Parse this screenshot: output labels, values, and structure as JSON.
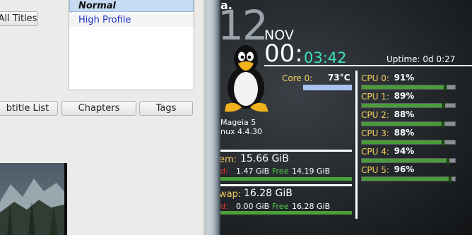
{
  "app": {
    "buttons": {
      "all_titles": "All Titles",
      "subtitle_list": "btitle List",
      "chapters": "Chapters",
      "tags": "Tags"
    },
    "tree": {
      "selected_label": "Normal",
      "item_label": "High Profile"
    }
  },
  "conky": {
    "top_fragment": "a.",
    "day": "12",
    "month": "NOV",
    "hours": "00:",
    "minutes_seconds": "03:42",
    "uptime": "Uptime: 0d 0:27",
    "core": {
      "label": "Core 0:",
      "temp": "73°C"
    },
    "distro": "Mageia 5",
    "kernel": "nux 4.4.30",
    "cpus": [
      {
        "label": "CPU 0:",
        "value": "91%",
        "level": 0.91
      },
      {
        "label": "CPU 1:",
        "value": "89%",
        "level": 0.89
      },
      {
        "label": "CPU 2:",
        "value": "88%",
        "level": 0.88
      },
      {
        "label": "CPU 3:",
        "value": "88%",
        "level": 0.88
      },
      {
        "label": "CPU 4:",
        "value": "94%",
        "level": 0.94
      },
      {
        "label": "CPU 5:",
        "value": "96%",
        "level": 0.96
      }
    ],
    "mem": {
      "title": "em:",
      "total": "15.66 GiB",
      "used_label": "d:",
      "used": "1.47 GiB",
      "free_label": "Free",
      "free": "14.19 GiB"
    },
    "swap": {
      "title": "wap:",
      "total": "16.28 GiB",
      "used_label": "d:",
      "used": "0.00 GiB",
      "free_label": "Free",
      "free": "16.28 GiB"
    },
    "colors": {
      "accent_yellow": "#f5d15c",
      "used_red": "#e0302a",
      "free_green": "#4fd14a",
      "bar_green": "#4a9c3a",
      "teal": "#3fe0c0",
      "core_bar": "#a9c2f0"
    }
  }
}
